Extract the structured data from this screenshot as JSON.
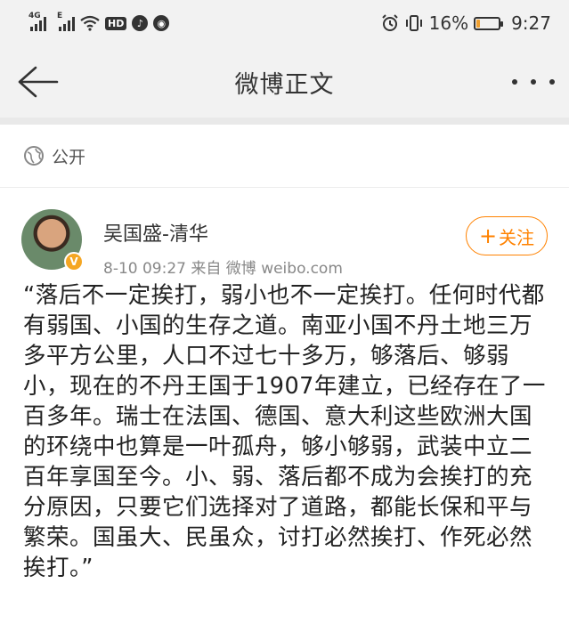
{
  "status_bar": {
    "sim1_label": "4G",
    "sim2_label": "E",
    "hd_label": "HD",
    "battery_text": "16%",
    "battery_level": 0.16,
    "time": "9:27"
  },
  "nav": {
    "title": "微博正文"
  },
  "visibility": {
    "label": "公开"
  },
  "author": {
    "name": "吴国盛-清华",
    "meta": "8-10 09:27  来自 微博 weibo.com",
    "verified_badge": "V"
  },
  "follow_button": {
    "plus": "+",
    "label": "关注"
  },
  "post": {
    "text": "“落后不一定挨打，弱小也不一定挨打。任何时代都有弱国、小国的生存之道。南亚小国不丹土地三万多平方公里，人口不过七十多万，够落后、够弱小，现在的不丹王国于1907年建立，已经存在了一百多年。瑞士在法国、德国、意大利这些欧洲大国的环绕中也算是一叶孤舟，够小够弱，武装中立二百年享国至今。小、弱、落后都不成为会挨打的充分原因，只要它们选择对了道路，都能长保和平与繁荣。国虽大、民虽众，讨打必然挨打、作死必然挨打。”"
  },
  "colors": {
    "accent": "#ff8200",
    "verified": "#f5a623",
    "header_bg": "#f2f2f2"
  }
}
